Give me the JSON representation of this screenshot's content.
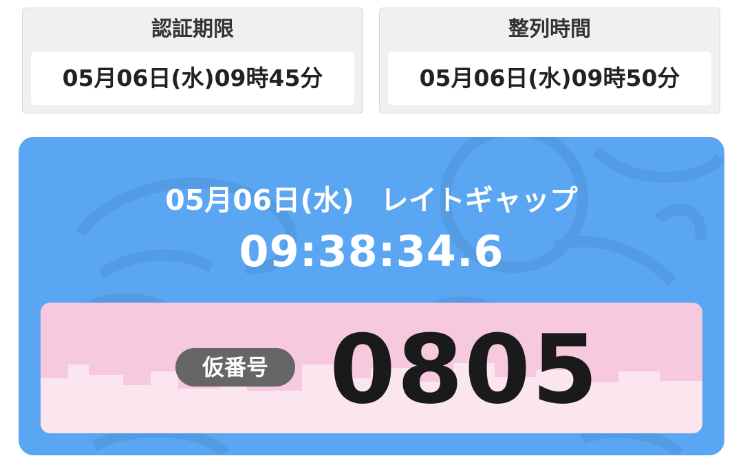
{
  "auth_deadline": {
    "label": "認証期限",
    "value": "05月06日(水)09時45分"
  },
  "line_up_time": {
    "label": "整列時間",
    "value": "05月06日(水)09時50分"
  },
  "ticket": {
    "date": "05月06日(水)",
    "event": "レイトギャップ",
    "clock": "09:38:34.6",
    "badge_label": "仮番号",
    "number": "0805"
  },
  "colors": {
    "ticket_bg": "#5aa6f2",
    "card_pink": "#f6c9de",
    "badge_gray": "#666666"
  }
}
